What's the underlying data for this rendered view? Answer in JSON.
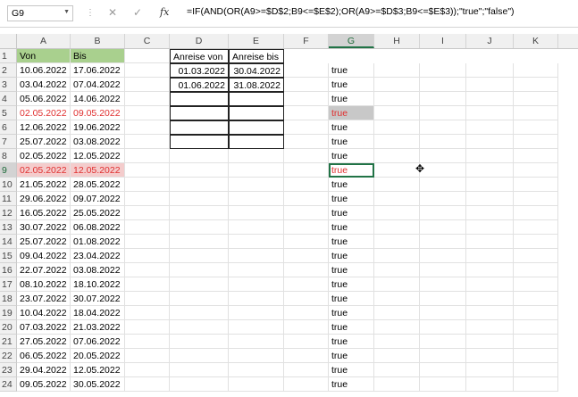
{
  "name_box": "G9",
  "formula": "=IF(AND(OR(A9>=$D$2;B9<=$E$2);OR(A9>=$D$3;B9<=$E$3));\"true\";\"false\")",
  "columns": [
    "A",
    "B",
    "C",
    "D",
    "E",
    "F",
    "G",
    "H",
    "I",
    "J",
    "K"
  ],
  "header_row": {
    "von": "Von",
    "bis": "Bis",
    "anreise_von": "Anreise von",
    "anreise_bis": "Anreise bis"
  },
  "lookup": [
    [
      "01.03.2022",
      "30.04.2022"
    ],
    [
      "01.06.2022",
      "31.08.2022"
    ]
  ],
  "rows": [
    {
      "n": "2",
      "a": "10.06.2022",
      "b": "17.06.2022",
      "g": "true"
    },
    {
      "n": "3",
      "a": "03.04.2022",
      "b": "07.04.2022",
      "g": "true"
    },
    {
      "n": "4",
      "a": "05.06.2022",
      "b": "14.06.2022",
      "g": "true"
    },
    {
      "n": "5",
      "a": "02.05.2022",
      "b": "09.05.2022",
      "g": "true"
    },
    {
      "n": "6",
      "a": "12.06.2022",
      "b": "19.06.2022",
      "g": "true"
    },
    {
      "n": "7",
      "a": "25.07.2022",
      "b": "03.08.2022",
      "g": "true"
    },
    {
      "n": "8",
      "a": "02.05.2022",
      "b": "12.05.2022",
      "g": "true"
    },
    {
      "n": "9",
      "a": "02.05.2022",
      "b": "12.05.2022",
      "g": "true"
    },
    {
      "n": "10",
      "a": "21.05.2022",
      "b": "28.05.2022",
      "g": "true"
    },
    {
      "n": "11",
      "a": "29.06.2022",
      "b": "09.07.2022",
      "g": "true"
    },
    {
      "n": "12",
      "a": "16.05.2022",
      "b": "25.05.2022",
      "g": "true"
    },
    {
      "n": "13",
      "a": "30.07.2022",
      "b": "06.08.2022",
      "g": "true"
    },
    {
      "n": "14",
      "a": "25.07.2022",
      "b": "01.08.2022",
      "g": "true"
    },
    {
      "n": "15",
      "a": "09.04.2022",
      "b": "23.04.2022",
      "g": "true"
    },
    {
      "n": "16",
      "a": "22.07.2022",
      "b": "03.08.2022",
      "g": "true"
    },
    {
      "n": "17",
      "a": "08.10.2022",
      "b": "18.10.2022",
      "g": "true"
    },
    {
      "n": "18",
      "a": "23.07.2022",
      "b": "30.07.2022",
      "g": "true"
    },
    {
      "n": "19",
      "a": "10.04.2022",
      "b": "18.04.2022",
      "g": "true"
    },
    {
      "n": "20",
      "a": "07.03.2022",
      "b": "21.03.2022",
      "g": "true"
    },
    {
      "n": "21",
      "a": "27.05.2022",
      "b": "07.06.2022",
      "g": "true"
    },
    {
      "n": "22",
      "a": "06.05.2022",
      "b": "20.05.2022",
      "g": "true"
    },
    {
      "n": "23",
      "a": "29.04.2022",
      "b": "12.05.2022",
      "g": "true"
    },
    {
      "n": "24",
      "a": "09.05.2022",
      "b": "30.05.2022",
      "g": "true"
    }
  ],
  "colors": {
    "header_green": "#a9d08e",
    "highlight_red": "#e03030",
    "selection_green": "#217346"
  }
}
